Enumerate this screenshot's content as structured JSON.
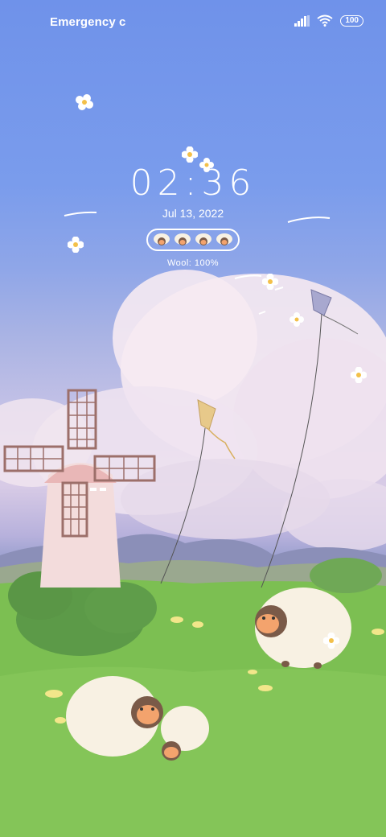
{
  "status_bar": {
    "left_text": "Emergency c",
    "battery_level": "100",
    "icons": [
      "signal-icon",
      "wifi-icon",
      "battery-icon"
    ]
  },
  "lock_screen": {
    "time": "02:36",
    "date": "Jul 13, 2022",
    "wool_label": "Wool: 100%",
    "wool_level_percent": 100,
    "sheep_count": 4
  },
  "colors": {
    "sky_top": "#6f92ea",
    "grass": "#7cbf52",
    "windmill": "#f3dcdc",
    "windmill_frame": "#9c6f6a",
    "kite": "#e7c98a"
  }
}
